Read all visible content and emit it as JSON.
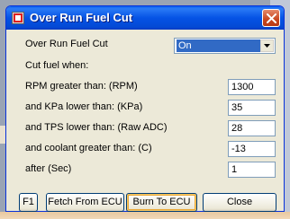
{
  "window": {
    "title": "Over Run Fuel Cut",
    "close_icon": "close-icon"
  },
  "form": {
    "mode_label": "Over Run Fuel Cut",
    "mode_value": "On",
    "cut_fuel_label": "Cut fuel when:",
    "rpm_label": "RPM greater than: (RPM)",
    "rpm_value": "1300",
    "kpa_label": "and KPa lower than:   (KPa)",
    "kpa_value": "35",
    "tps_label": "and TPS lower than:   (Raw ADC)",
    "tps_value": "28",
    "coolant_label": "and coolant greater than: (C)",
    "coolant_value": "-13",
    "after_label": "after (Sec)",
    "after_value": "1"
  },
  "buttons": {
    "f1": "F1",
    "fetch": "Fetch From ECU",
    "burn": "Burn To ECU",
    "close": "Close"
  },
  "colors": {
    "titlebar": "#0553e5",
    "dialog_bg": "#ece9d8",
    "selection": "#316ac5",
    "close_button": "#c8461f"
  }
}
